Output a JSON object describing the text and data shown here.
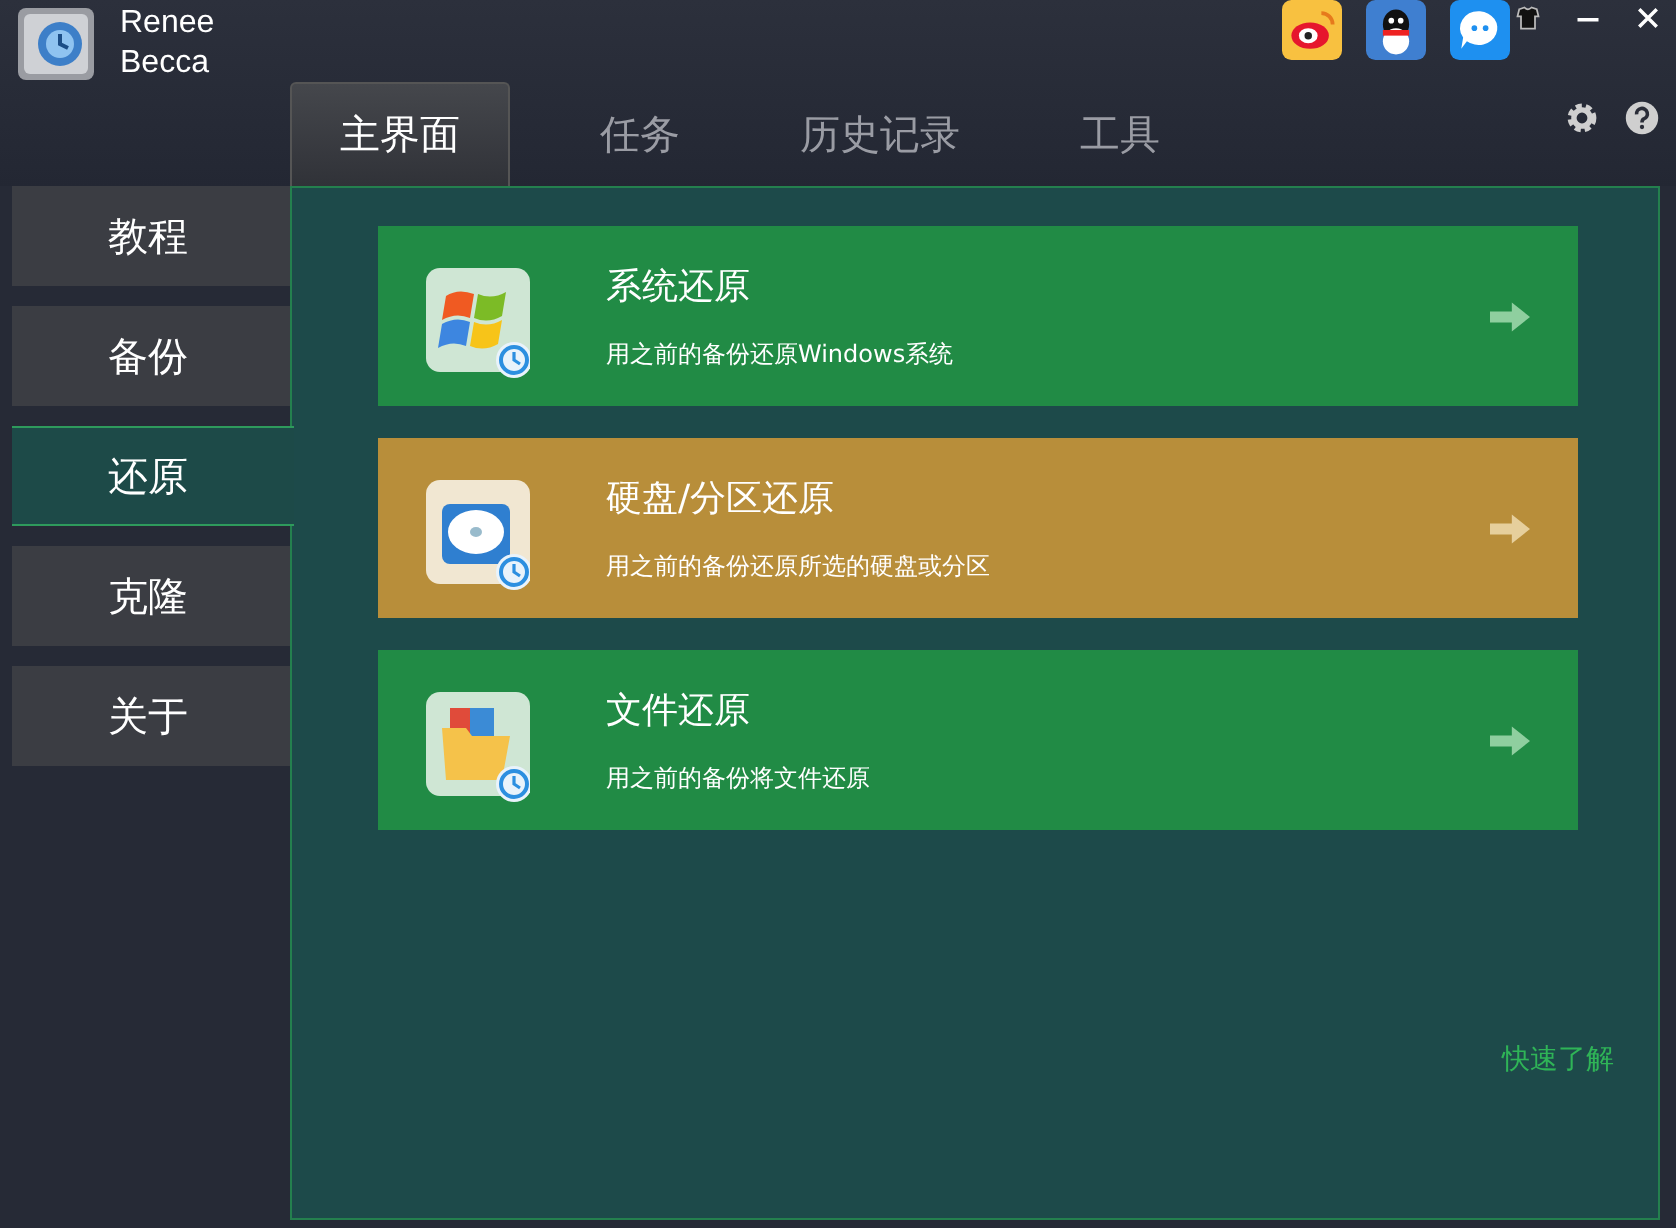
{
  "app": {
    "name_line1": "Renee",
    "name_line2": "Becca"
  },
  "tabs": [
    {
      "label": "主界面",
      "selected": true
    },
    {
      "label": "任务",
      "selected": false
    },
    {
      "label": "历史记录",
      "selected": false
    },
    {
      "label": "工具",
      "selected": false
    }
  ],
  "sidebar": {
    "items": [
      {
        "label": "教程",
        "selected": false
      },
      {
        "label": "备份",
        "selected": false
      },
      {
        "label": "还原",
        "selected": true
      },
      {
        "label": "克隆",
        "selected": false
      },
      {
        "label": "关于",
        "selected": false
      }
    ]
  },
  "cards": [
    {
      "kind": "windows",
      "title": "系统还原",
      "description": "用之前的备份还原Windows系统",
      "highlighted": false
    },
    {
      "kind": "disk",
      "title": "硬盘/分区还原",
      "description": "用之前的备份还原所选的硬盘或分区",
      "highlighted": true
    },
    {
      "kind": "folder",
      "title": "文件还原",
      "description": "用之前的备份将文件还原",
      "highlighted": false
    }
  ],
  "quick_link": "快速了解"
}
